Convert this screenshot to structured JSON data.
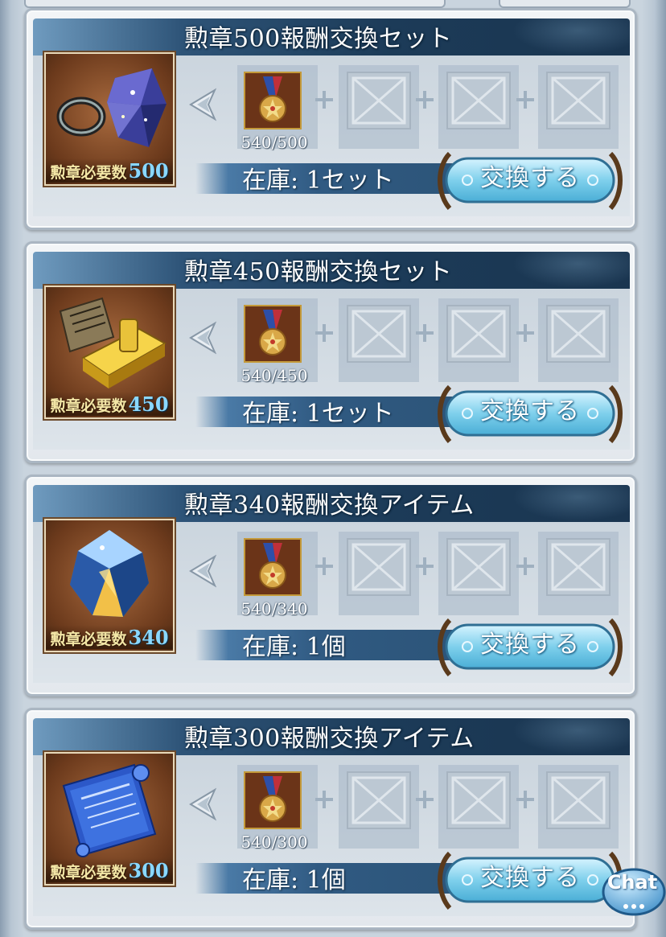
{
  "cards": [
    {
      "title": "勲章500報酬交換セット",
      "required_label": "勲章必要数",
      "required_value": "500",
      "medal_count": "540/500",
      "stock": "在庫: 1セット",
      "button_label": "交換する",
      "reward_icon": "ring-and-crystal-icon"
    },
    {
      "title": "勲章450報酬交換セット",
      "required_label": "勲章必要数",
      "required_value": "450",
      "medal_count": "540/450",
      "stock": "在庫: 1セット",
      "button_label": "交換する",
      "reward_icon": "gold-bar-and-scroll-icon"
    },
    {
      "title": "勲章340報酬交換アイテム",
      "required_label": "勲章必要数",
      "required_value": "340",
      "medal_count": "540/340",
      "stock": "在庫: 1個",
      "button_label": "交換する",
      "reward_icon": "gem-icon"
    },
    {
      "title": "勲章300報酬交換アイテム",
      "required_label": "勲章必要数",
      "required_value": "300",
      "medal_count": "540/300",
      "stock": "在庫: 1個",
      "button_label": "交換する",
      "reward_icon": "blue-scroll-icon"
    }
  ],
  "chat": {
    "label": "Chat"
  },
  "colors": {
    "title_band": "#1c3b58",
    "stock_band": "#305a82",
    "button_fill": "#7fd0ec",
    "required_number": "#8ad8ff"
  }
}
